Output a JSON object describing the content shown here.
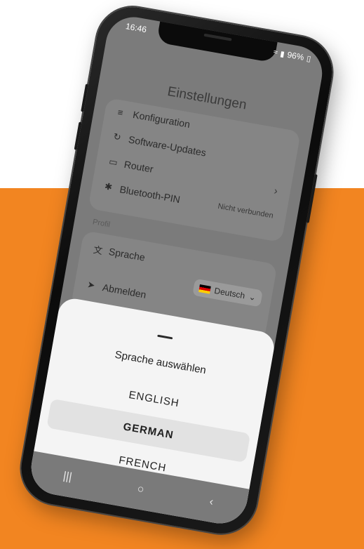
{
  "status_bar": {
    "time": "16:46",
    "battery": "96%"
  },
  "settings": {
    "title": "Einstellungen",
    "rows": [
      {
        "icon": "sliders-icon",
        "label": "Konfiguration"
      },
      {
        "icon": "refresh-icon",
        "label": "Software-Updates"
      },
      {
        "icon": "router-icon",
        "label": "Router"
      },
      {
        "icon": "bluetooth-icon",
        "label": "Bluetooth-PIN",
        "value": "Nicht verbunden"
      }
    ],
    "profile_label": "Profil",
    "profile_rows": [
      {
        "icon": "translate-icon",
        "label": "Sprache",
        "value": "Deutsch"
      },
      {
        "icon": "logout-icon",
        "label": "Abmelden"
      }
    ]
  },
  "sheet": {
    "title": "Sprache auswählen",
    "options": [
      "ENGLISH",
      "GERMAN",
      "FRENCH"
    ],
    "selected": "GERMAN"
  },
  "colors": {
    "background_band": "#f28521",
    "sheet_bg": "#f4f4f4",
    "dim_overlay": "#7b7b7b"
  }
}
